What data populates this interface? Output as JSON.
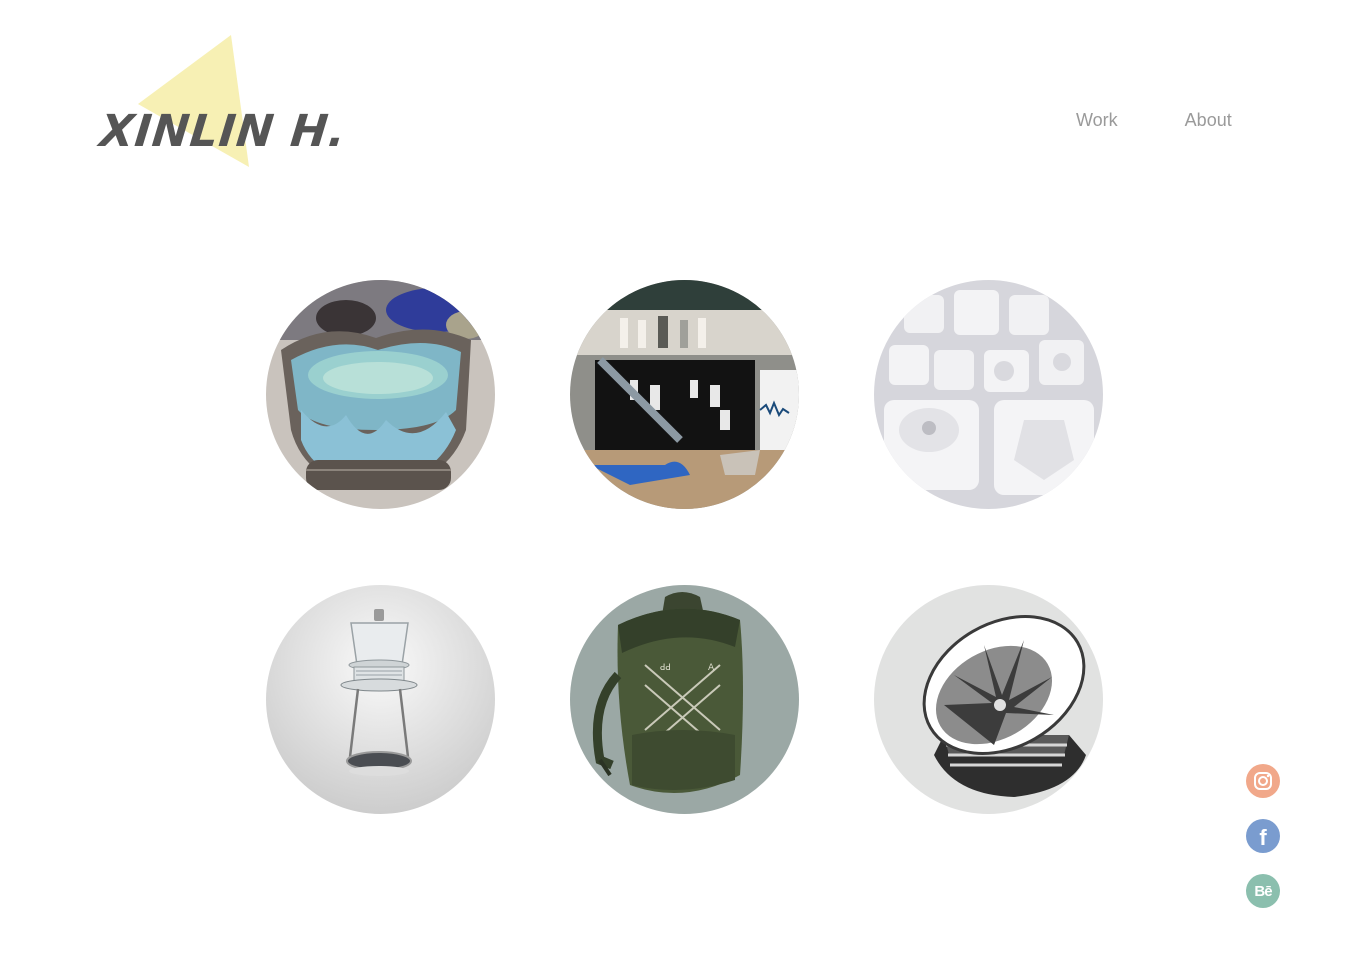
{
  "header": {
    "logo_text": "XINLIN H.",
    "logo_accent_color": "#f7f0b4"
  },
  "nav": {
    "items": [
      {
        "label": "Work"
      },
      {
        "label": "About"
      }
    ]
  },
  "gallery": {
    "tiles": [
      {
        "subject": "blue-glazed ceramic bowl"
      },
      {
        "subject": "ceramics exhibition table"
      },
      {
        "subject": "white plaster molds"
      },
      {
        "subject": "glass tea infuser render"
      },
      {
        "subject": "green backpack illustration"
      },
      {
        "subject": "speaker horn illustration"
      }
    ]
  },
  "social": {
    "items": [
      {
        "icon": "instagram-icon",
        "color": "#f1a88a"
      },
      {
        "icon": "facebook-icon",
        "color": "#7a9ccf",
        "glyph": "f"
      },
      {
        "icon": "behance-icon",
        "color": "#8bbfae",
        "glyph": "Bē"
      }
    ]
  }
}
